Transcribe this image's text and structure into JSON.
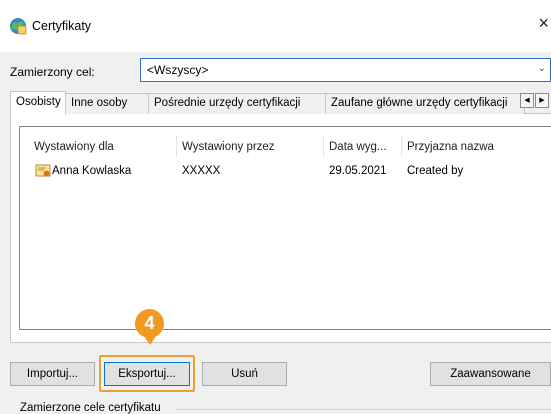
{
  "window": {
    "title": "Certyfikaty",
    "close_glyph": "×"
  },
  "purpose": {
    "label": "Zamierzony cel:",
    "value": "<Wszyscy>"
  },
  "tabs": [
    {
      "label": "Osobisty",
      "active": true
    },
    {
      "label": "Inne osoby"
    },
    {
      "label": "Pośrednie urzędy certyfikacji"
    },
    {
      "label": "Zaufane główne urzędy certyfikacji"
    }
  ],
  "tab_scroll": {
    "left": "◀",
    "right": "▶"
  },
  "list": {
    "columns": [
      "Wystawiony dla",
      "Wystawiony przez",
      "Data wyg...",
      "Przyjazna nazwa"
    ],
    "rows": [
      {
        "issued_to": "Anna Kowlaska",
        "issued_by": "XXXXX",
        "expires": "29.05.2021",
        "friendly_name": "Created by"
      }
    ]
  },
  "buttons": {
    "import": "Importuj...",
    "export": "Eksportuj...",
    "remove": "Usuń",
    "advanced": "Zaawansowane"
  },
  "step_badge": "4",
  "accent_color": "#f09a1e",
  "group_label": "Zamierzone cele certyfikatu"
}
